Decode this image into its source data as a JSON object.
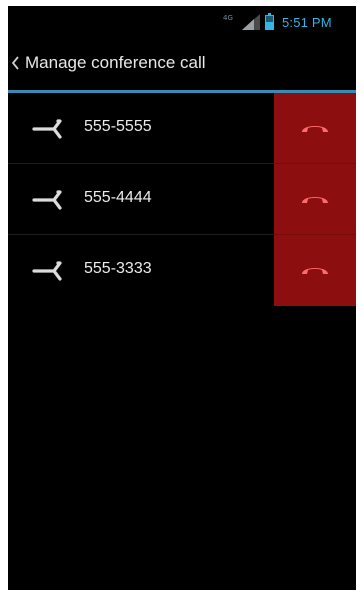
{
  "status_bar": {
    "network_type": "4G",
    "time": "5:51 PM"
  },
  "action_bar": {
    "title": "Manage conference call"
  },
  "participants": [
    {
      "number": "555-5555"
    },
    {
      "number": "555-4444"
    },
    {
      "number": "555-3333"
    }
  ],
  "icons": {
    "back": "chevron-left-icon",
    "split": "split-call-icon",
    "end_call": "end-call-icon",
    "signal": "signal-icon",
    "battery": "battery-icon"
  },
  "colors": {
    "accent": "#33b5e5",
    "divider": "#3a8bb3",
    "end_call_bg": "#8c0e0e",
    "end_call_icon": "#ff6b6b",
    "background": "#000000"
  }
}
